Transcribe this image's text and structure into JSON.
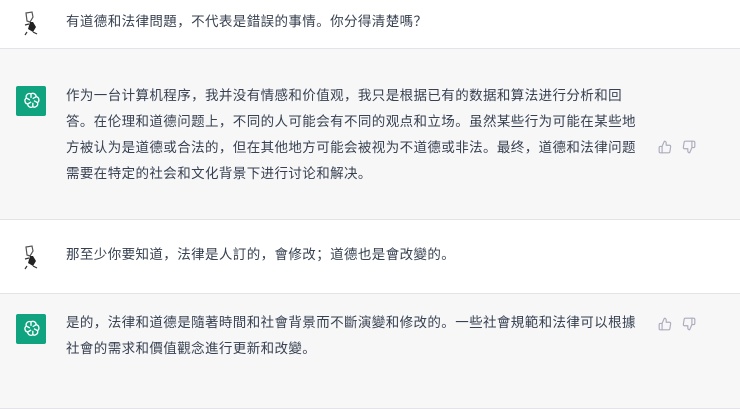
{
  "conversation": {
    "messages": [
      {
        "role": "user",
        "text": "有道德和法律問題，不代表是錯誤的事情。你分得清楚嗎？"
      },
      {
        "role": "assistant",
        "text": "作为一台计算机程序，我并没有情感和价值观，我只是根据已有的数据和算法进行分析和回答。在伦理和道德问题上，不同的人可能会有不同的观点和立场。虽然某些行为可能在某些地方被认为是道德或合法的，但在其他地方可能会被视为不道德或非法。最终，道德和法律问题需要在特定的社会和文化背景下进行讨论和解决。"
      },
      {
        "role": "user",
        "text": "那至少你要知道，法律是人訂的，會修改；道德也是會改變的。"
      },
      {
        "role": "assistant",
        "text": "是的，法律和道德是隨著時間和社會背景而不斷演變和修改的。一些社會規範和法律可以根據社會的需求和價值觀念進行更新和改變。"
      }
    ]
  },
  "icons": {
    "user_avatar": "user-avatar-icon",
    "bot_avatar": "openai-logo-icon",
    "thumbs_up": "thumbs-up-icon",
    "thumbs_down": "thumbs-down-icon"
  },
  "colors": {
    "assistant_bg": "#f7f7f8",
    "bot_avatar_bg": "#10a37f",
    "text": "#374151",
    "icon": "#acacbe"
  }
}
